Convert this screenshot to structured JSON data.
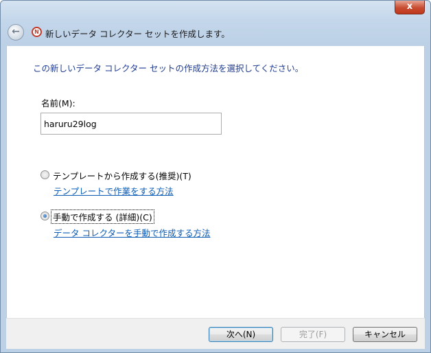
{
  "window": {
    "close_glyph": "x",
    "title": "新しいデータ コレクター セットを作成します。",
    "back_glyph": "←",
    "app_icon_glyph": "N"
  },
  "main": {
    "heading": "この新しいデータ コレクター セットの作成方法を選択してください。",
    "name_label": "名前(M):",
    "name_value": "haruru29log",
    "options": [
      {
        "label": "テンプレートから作成する(推奨)(T)",
        "checked": false,
        "link": "テンプレートで作業をする方法"
      },
      {
        "label": "手動で作成する (詳細)(C)",
        "checked": true,
        "link": "データ コレクターを手動で作成する方法"
      }
    ]
  },
  "footer": {
    "next_label": "次へ(N)",
    "finish_label": "完了(F)",
    "cancel_label": "キャンセル"
  }
}
